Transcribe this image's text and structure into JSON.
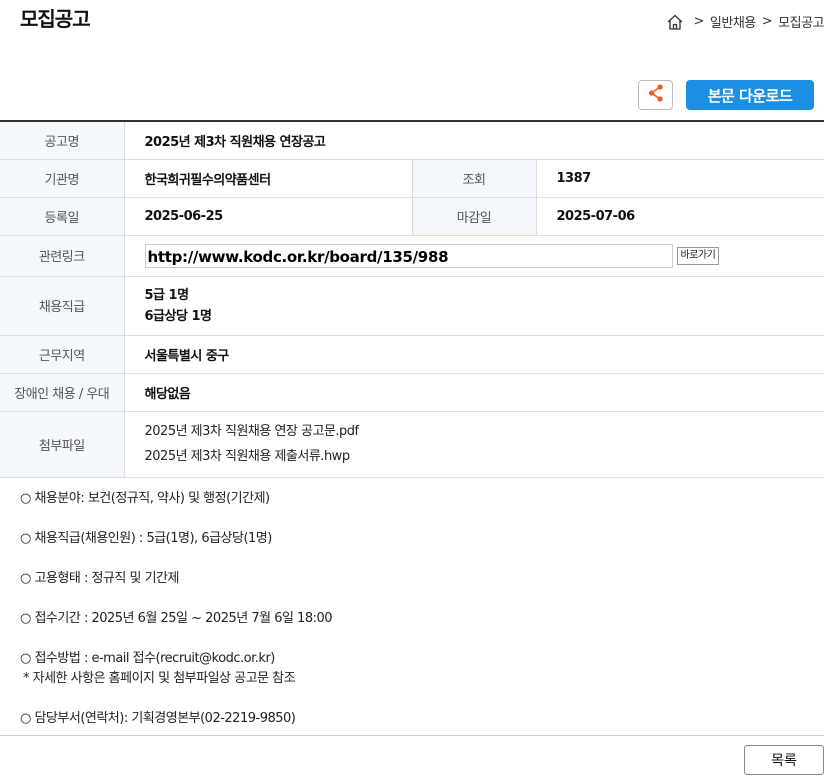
{
  "page": {
    "title": "모집공고"
  },
  "breadcrumb": {
    "home_icon": "home-icon",
    "items": [
      "일반채용",
      "모집공고"
    ],
    "separator": ">"
  },
  "toolbar": {
    "share_icon": "share-icon",
    "download_label": "본문 다운로드",
    "accent_color": "#1a8fe3"
  },
  "info": {
    "title_label": "공고명",
    "title_value": "2025년 제3차 직원채용 연장공고",
    "org_label": "기관명",
    "org_value": "한국희귀필수의약품센터",
    "views_label": "조회",
    "views_value": "1387",
    "reg_label": "등록일",
    "reg_value": "2025-06-25",
    "deadline_label": "마감일",
    "deadline_value": "2025-07-06",
    "link_label": "관련링크",
    "link_value": "http://www.kodc.or.kr/board/135/988",
    "link_button": "바로가기",
    "grade_label": "채용직급",
    "grades": [
      "5급 1명",
      "6급상당 1명"
    ],
    "location_label": "근무지역",
    "location_value": "서울특별시 중구",
    "disability_label": "장애인 채용 / 우대",
    "disability_value": "해당없음",
    "attach_label": "첨부파일",
    "attachments": [
      "2025년 제3차 직원채용 연장 공고문.pdf",
      "2025년 제3차 직원채용 제출서류.hwp"
    ]
  },
  "details": [
    "○ 채용분야:  보건(정규직, 약사) 및 행정(기간제)",
    "○ 채용직급(채용인원) : 5급(1명), 6급상당(1명)",
    "○ 고용형태 : 정규직 및 기간제",
    "○ 접수기간 : 2025년 6월 25일 ~ 2025년 7월 6일 18:00",
    "○ 접수방법 : e-mail 접수(recruit@kodc.or.kr)",
    "* 자세한 사항은  홈페이지 및 첨부파일상 공고문 참조",
    "○ 담당부서(연락처): 기획경영본부(02-2219-9850)"
  ],
  "footer": {
    "list_button": "목록"
  }
}
